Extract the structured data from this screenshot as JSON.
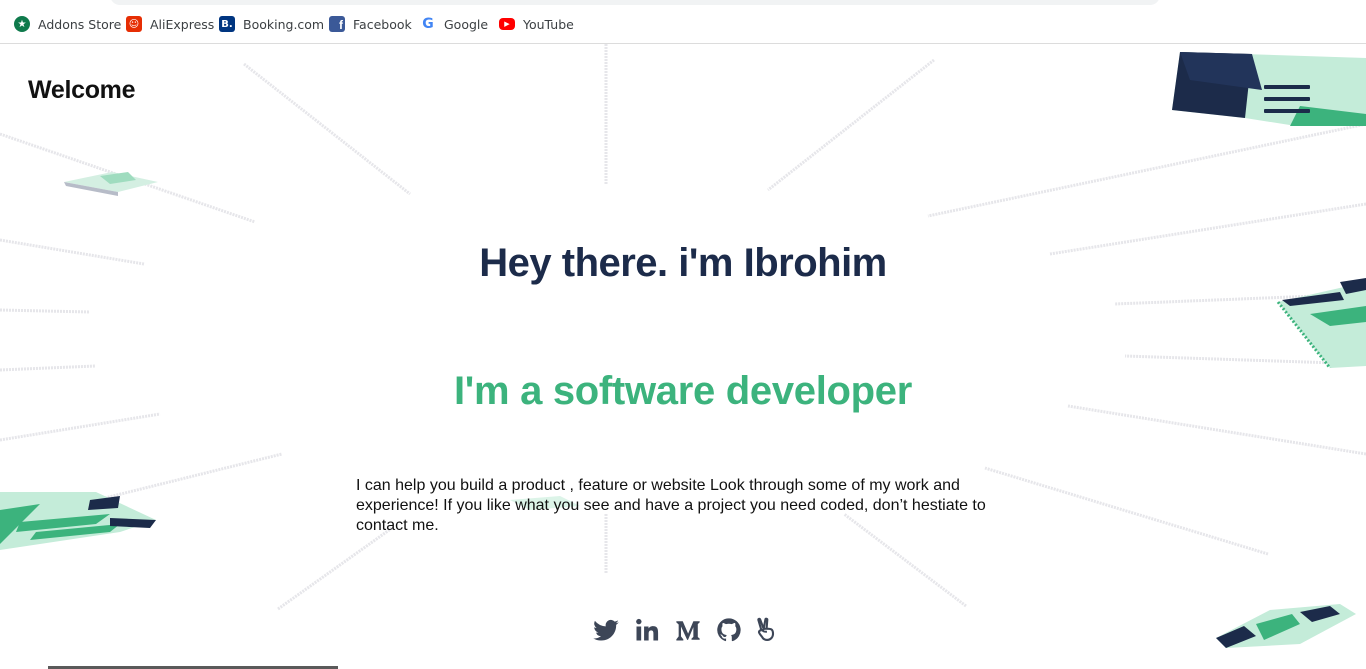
{
  "bookmarks": [
    {
      "label": "Addons Store",
      "icon": "addons-store-icon",
      "color": "#0f7a4c"
    },
    {
      "label": "AliExpress",
      "icon": "aliexpress-icon",
      "color": "#e62e04"
    },
    {
      "label": "Booking.com",
      "icon": "booking-icon",
      "color": "#003580"
    },
    {
      "label": "Facebook",
      "icon": "facebook-icon",
      "color": "#3b5998"
    },
    {
      "label": "Google",
      "icon": "google-icon",
      "color": "#4285f4"
    },
    {
      "label": "YouTube",
      "icon": "youtube-icon",
      "color": "#ff0000"
    }
  ],
  "header": {
    "welcome": "Welcome",
    "menu_icon": "hamburger-menu-icon"
  },
  "hero": {
    "title": "Hey there. i'm Ibrohim",
    "subtitle": "I'm a software developer",
    "intro": "I can help you build a product , feature or website Look through some of my work and experience! If you like what you see and have a project you need coded, don’t hestiate to contact me."
  },
  "social": [
    "twitter-icon",
    "linkedin-icon",
    "medium-icon",
    "github-icon",
    "angellist-icon"
  ],
  "colors": {
    "navy": "#1c2b4a",
    "green": "#3cb37d",
    "mint": "#c4ecd9"
  }
}
